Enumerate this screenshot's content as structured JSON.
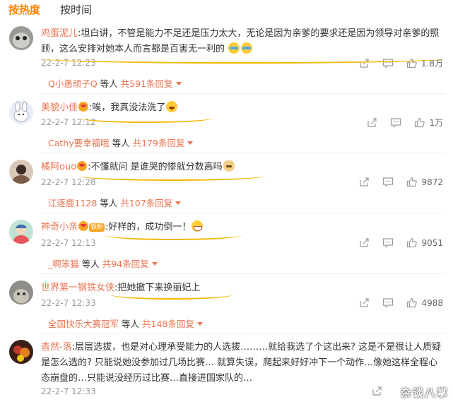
{
  "tabs": {
    "hot": "按热度",
    "time": "按时间"
  },
  "comments": [
    {
      "user": "鸡蛋泥儿",
      "text": ":坦白讲，不管是能力不足还是压力太大，无论是因为亲爹的要求还是因为领导对亲爹的照顾，这么安排对她本人而言都是百害无一利的",
      "time": "22-2-7 12:23",
      "likes": "1.8万",
      "reply_user": "Q小愚顽子Q",
      "reply_mid": "等人",
      "reply_total": "共591条回复"
    },
    {
      "user": "美貌小佳",
      "text": ":唉，我真没法洗了",
      "time": "22-2-7 12:12",
      "likes": "1万",
      "reply_user": "Cathy要幸福哦",
      "reply_mid": "等人",
      "reply_total": "共179条回复"
    },
    {
      "user": "橘阿ouo",
      "text": ":不懂就问 是谁哭的惨就分数高吗",
      "time": "22-2-7 12:28",
      "likes": "9872",
      "reply_user": "江逐鹿1128",
      "reply_mid": "等人",
      "reply_total": "共107条回复"
    },
    {
      "user": "神奇小亲",
      "badge": "铁粉",
      "text": ":好样的，成功倒一！",
      "time": "22-2-7 12:13",
      "likes": "9051",
      "reply_user": "_啊笨猫",
      "reply_mid": "等人",
      "reply_total": "共94条回复"
    },
    {
      "user": "世界第一钢铁女侠",
      "text": ":把她撤下来换丽妃上",
      "time": "22-2-7 12:33",
      "likes": "4988",
      "reply_user": "全国快乐大赛冠军",
      "reply_mid": "等人",
      "reply_total": "共148条回复"
    },
    {
      "user": "杳然-落",
      "text": ":层层选拔，也是对心理承受能力的人选拔………就给我选了个这出来? 这是不是很让人质疑是怎么选的? 只能说她没参加过几场比赛… 就算失误，爬起来好好冲下一个动作…像她这样全程心态崩盘的…只能说没经历过比赛…直接进国家队的…",
      "time": "22-2-7 12:33"
    }
  ],
  "watermark": "杂谈八掌",
  "colors": {
    "accent": "#ff8200",
    "link": "#eb7350",
    "highlight": "#f5b800"
  },
  "icons": [
    "share-icon",
    "comment-icon",
    "like-icon"
  ]
}
